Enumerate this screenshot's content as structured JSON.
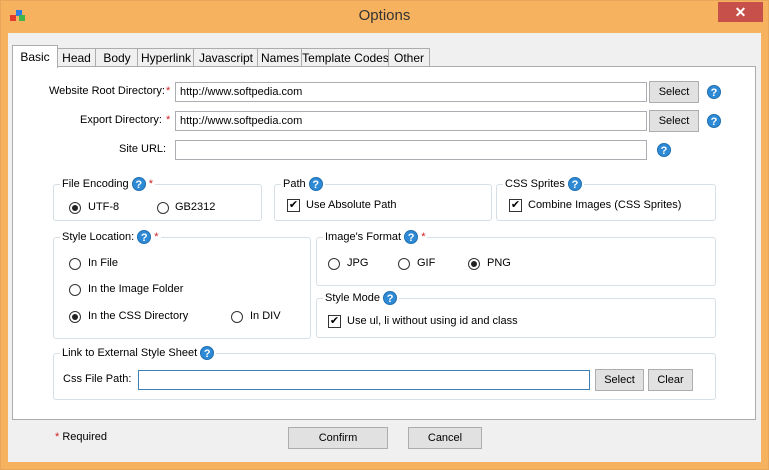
{
  "window": {
    "title": "Options",
    "close_symbol": "✕"
  },
  "tabs": [
    {
      "label": "Basic"
    },
    {
      "label": "Head"
    },
    {
      "label": "Body"
    },
    {
      "label": "Hyperlink"
    },
    {
      "label": "Javascript"
    },
    {
      "label": "Names"
    },
    {
      "label": "Template Codes"
    },
    {
      "label": "Other"
    }
  ],
  "fields": {
    "root_dir_label": "Website Root Directory:",
    "root_dir_value": "http://www.softpedia.com",
    "export_dir_label": "Export Directory:",
    "export_dir_value": "http://www.softpedia.com",
    "site_url_label": "Site URL:",
    "site_url_value": "",
    "required_mark": "*",
    "select_label": "Select",
    "help_symbol": "?"
  },
  "file_encoding": {
    "title": "File Encoding",
    "options": [
      "UTF-8",
      "GB2312"
    ],
    "selected": "UTF-8"
  },
  "path": {
    "title": "Path",
    "option": "Use Absolute Path",
    "checked": true
  },
  "css_sprites": {
    "title": "CSS Sprites",
    "option": "Combine Images (CSS Sprites)",
    "checked": true
  },
  "style_location": {
    "title": "Style Location:",
    "options": [
      "In File",
      "In the Image Folder",
      "In the CSS Directory",
      "In DIV"
    ],
    "selected": "In the CSS Directory"
  },
  "image_format": {
    "title": "Image's Format",
    "options": [
      "JPG",
      "GIF",
      "PNG"
    ],
    "selected": "PNG"
  },
  "style_mode": {
    "title": "Style Mode",
    "option": "Use ul, li without using id and class",
    "checked": true
  },
  "external_style": {
    "title": "Link to External Style Sheet",
    "css_path_label": "Css File Path:",
    "css_path_value": "",
    "select_label": "Select",
    "clear_label": "Clear"
  },
  "footer": {
    "required_text": "Required",
    "confirm_label": "Confirm",
    "cancel_label": "Cancel"
  }
}
